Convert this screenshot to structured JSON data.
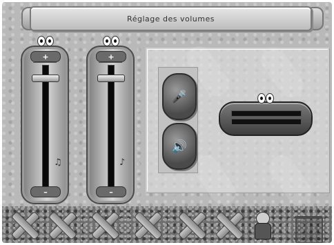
{
  "header": {
    "title": "Réglage des volumes"
  },
  "sliders": [
    {
      "name": "volume-slider-1",
      "plus": "+",
      "minus": "–",
      "level": 0.92,
      "icon": "♫"
    },
    {
      "name": "volume-slider-2",
      "plus": "+",
      "minus": "–",
      "level": 0.92,
      "icon": "♪"
    }
  ],
  "panel": {
    "mic_button": {
      "icon": "microphone-icon",
      "glyph": "🎤"
    },
    "speaker_button": {
      "icon": "speaker-icon",
      "glyph": "🔊"
    },
    "meter": {
      "level_top": 0.0,
      "level_bottom": 0.0
    }
  },
  "footer": {
    "icons": [
      "cross-icon",
      "cross-icon",
      "cross-icon",
      "cross-icon",
      "cross-icon",
      "cross-icon",
      "character-icon",
      "stand-icon"
    ]
  }
}
